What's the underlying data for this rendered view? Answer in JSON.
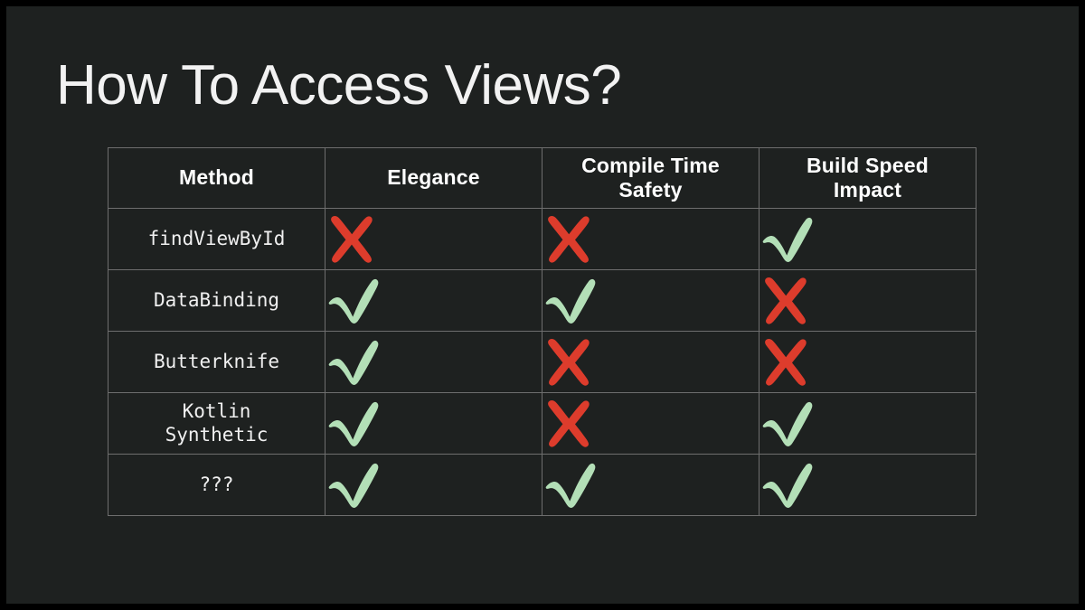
{
  "slide": {
    "title": "How To Access Views?",
    "background_color": "#1e2120",
    "letterbox_color": "#000000",
    "title_color": "#f2f2f2",
    "border_color": "#6e6e6e"
  },
  "marks": {
    "check_color": "#b3dfb7",
    "cross_color": "#dd3c2c",
    "check_name": "check-mark-icon",
    "cross_name": "cross-mark-icon"
  },
  "table": {
    "headers": [
      {
        "text": "Method",
        "lines": [
          "Method"
        ]
      },
      {
        "text": "Elegance",
        "lines": [
          "Elegance"
        ]
      },
      {
        "text": "Compile Time Safety",
        "lines": [
          "Compile Time",
          "Safety"
        ]
      },
      {
        "text": "Build Speed Impact",
        "lines": [
          "Build Speed",
          "Impact"
        ]
      }
    ],
    "rows": [
      {
        "method": "findViewById",
        "method_lines": [
          "findViewById"
        ],
        "elegance": "cross",
        "compile_time_safety": "cross",
        "build_speed_impact": "check"
      },
      {
        "method": "DataBinding",
        "method_lines": [
          "DataBinding"
        ],
        "elegance": "check",
        "compile_time_safety": "check",
        "build_speed_impact": "cross"
      },
      {
        "method": "Butterknife",
        "method_lines": [
          "Butterknife"
        ],
        "elegance": "check",
        "compile_time_safety": "cross",
        "build_speed_impact": "cross"
      },
      {
        "method": "Kotlin Synthetic",
        "method_lines": [
          "Kotlin",
          "Synthetic"
        ],
        "elegance": "check",
        "compile_time_safety": "cross",
        "build_speed_impact": "check"
      },
      {
        "method": "???",
        "method_lines": [
          "???"
        ],
        "elegance": "check",
        "compile_time_safety": "check",
        "build_speed_impact": "check"
      }
    ]
  }
}
